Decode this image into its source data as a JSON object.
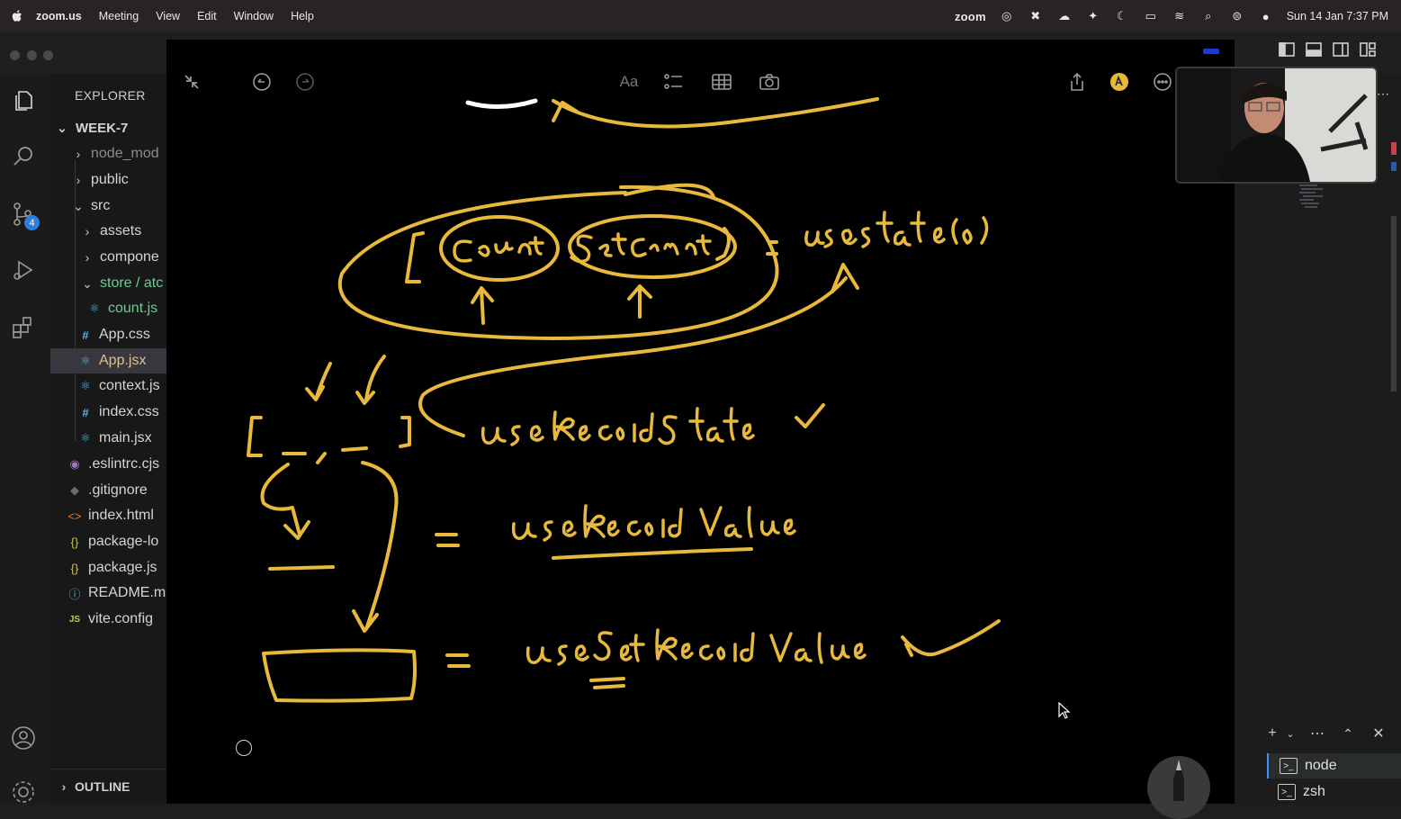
{
  "menubar": {
    "app": "zoom.us",
    "items": [
      "Meeting",
      "View",
      "Edit",
      "Window",
      "Help"
    ],
    "zoom_label": "zoom",
    "datetime": "Sun 14 Jan  7:37 PM"
  },
  "activity": {
    "scm_badge": "4"
  },
  "explorer": {
    "header": "EXPLORER",
    "root": "WEEK-7",
    "items": [
      {
        "label": "node_mod",
        "icon": "folder-chevron"
      },
      {
        "label": "public",
        "icon": "folder-chevron"
      },
      {
        "label": "src",
        "icon": "folder-open-chevron"
      },
      {
        "label": "assets",
        "icon": "folder-chevron"
      },
      {
        "label": "compone",
        "icon": "folder-chevron"
      },
      {
        "label": "store / atc",
        "icon": "folder-open-chevron"
      },
      {
        "label": "count.js",
        "icon": "react-icon"
      },
      {
        "label": "App.css",
        "icon": "hash-icon"
      },
      {
        "label": "App.jsx",
        "icon": "react-icon"
      },
      {
        "label": "context.js",
        "icon": "react-icon"
      },
      {
        "label": "index.css",
        "icon": "hash-icon"
      },
      {
        "label": "main.jsx",
        "icon": "react-icon"
      },
      {
        "label": ".eslintrc.cjs",
        "icon": "eslint-icon"
      },
      {
        "label": ".gitignore",
        "icon": "git-icon"
      },
      {
        "label": "index.html",
        "icon": "html-icon"
      },
      {
        "label": "package-lo",
        "icon": "json-icon"
      },
      {
        "label": "package.js",
        "icon": "json-icon"
      },
      {
        "label": "README.m",
        "icon": "info-icon"
      },
      {
        "label": "vite.config",
        "icon": "js-icon"
      }
    ],
    "outline": "OUTLINE"
  },
  "board": {
    "toolbar_text_label": "Aa"
  },
  "terminal": {
    "sessions": [
      "node",
      "zsh"
    ]
  },
  "colors": {
    "ink": "#e8b93a",
    "board_bg": "#000000",
    "selection": "#37373d"
  }
}
